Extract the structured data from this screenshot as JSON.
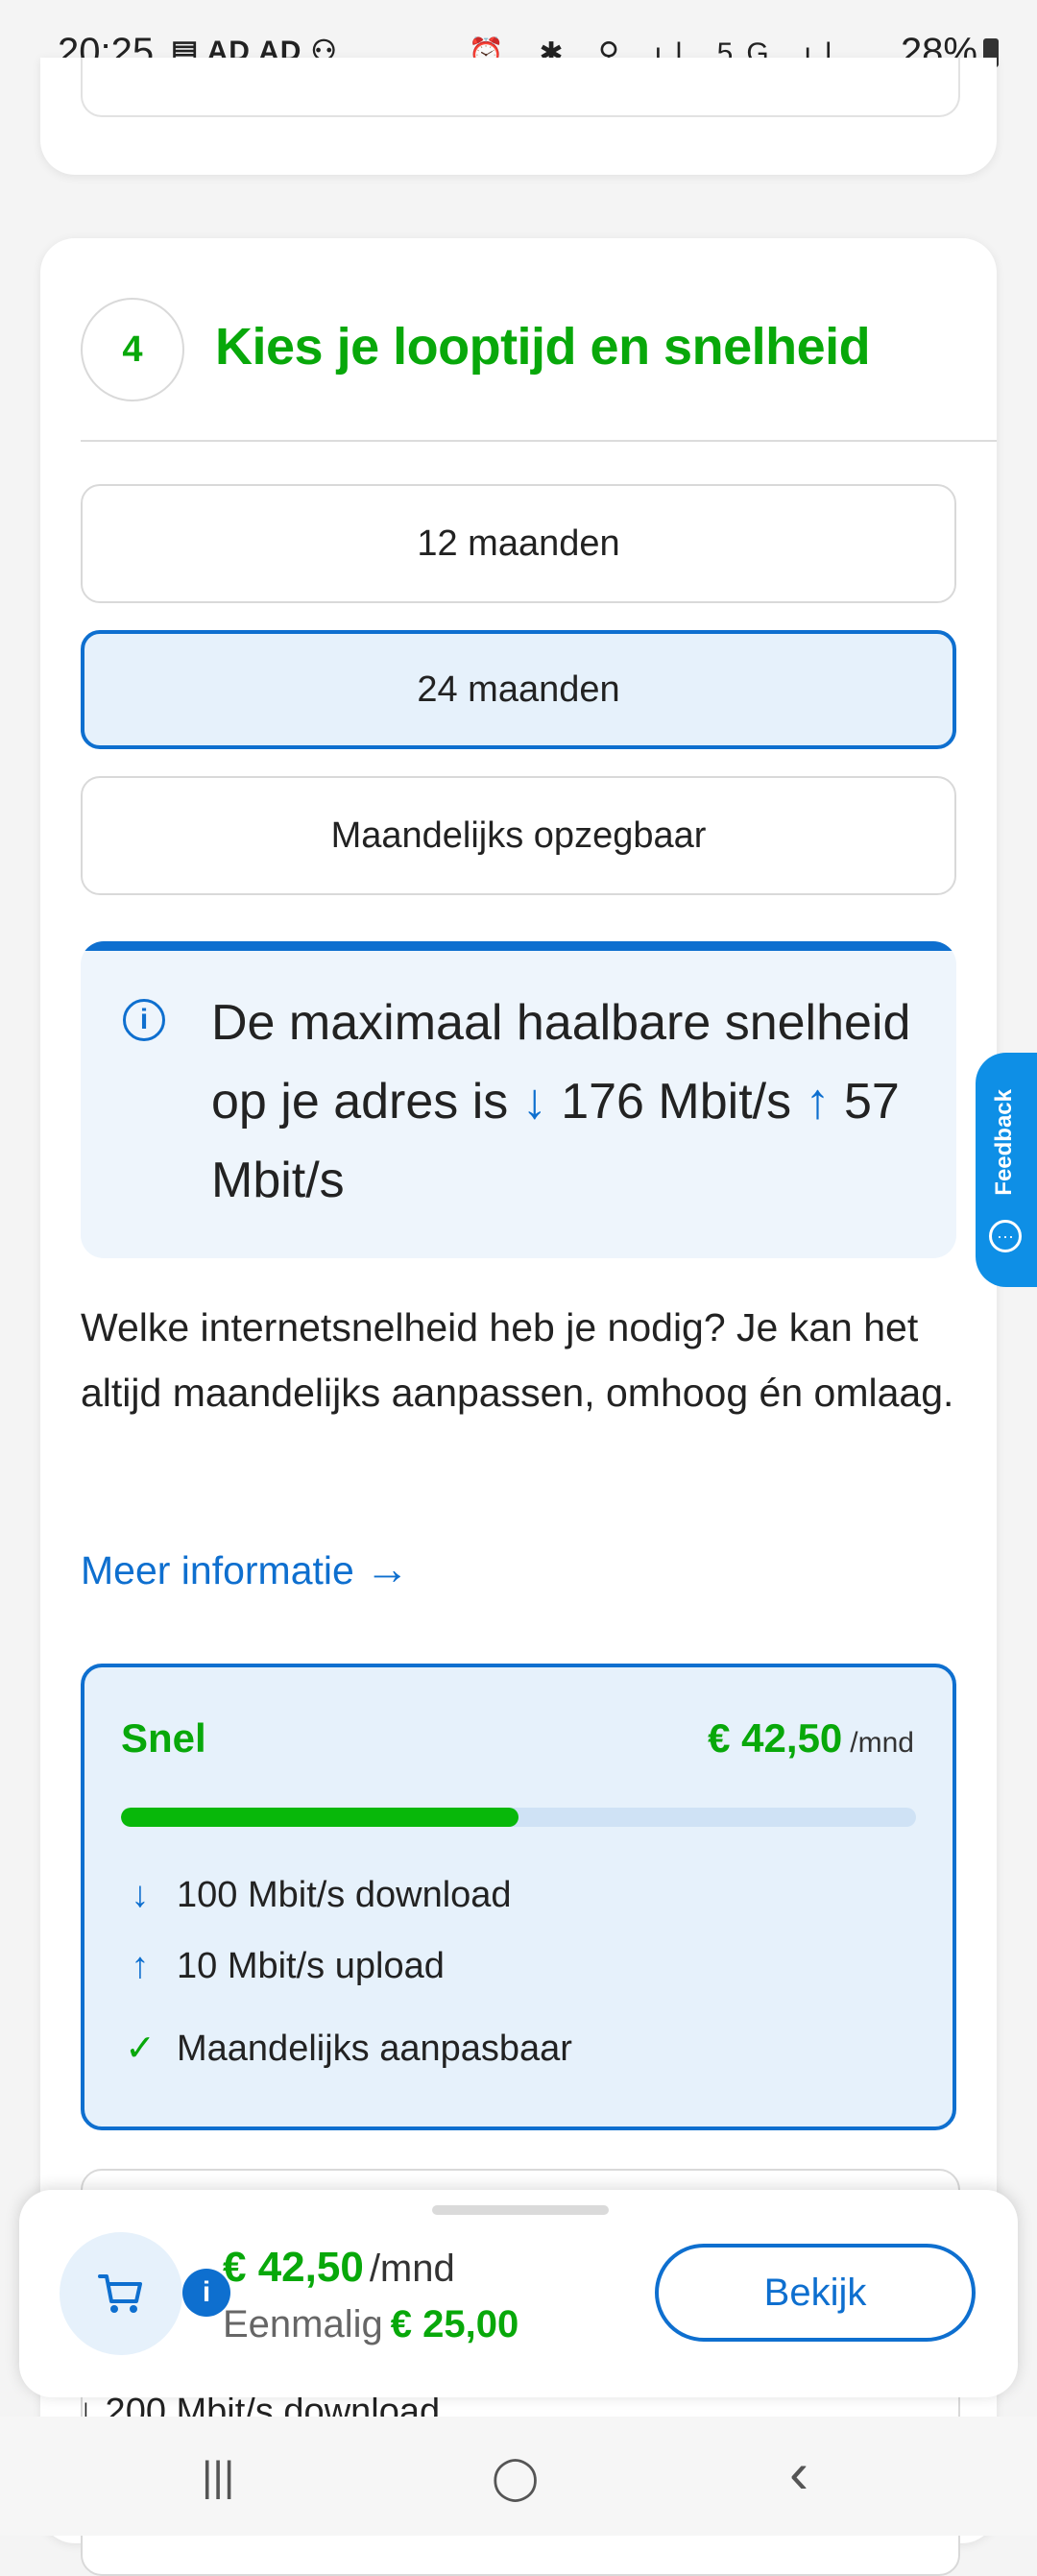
{
  "status_bar": {
    "time": "20:25",
    "left_icons": "▤ AD AD ⚇",
    "right_icons": "⏰ ✱ ⚲ ıl 5G ıl",
    "battery": "28%"
  },
  "step": {
    "number": "4",
    "title": "Kies je looptijd en snelheid"
  },
  "terms": [
    {
      "label": "12 maanden",
      "selected": false
    },
    {
      "label": "24 maanden",
      "selected": true
    },
    {
      "label": "Maandelijks opzegbaar",
      "selected": false
    }
  ],
  "info": {
    "icon": "info-icon",
    "text_before": "De maximaal haalbare snelheid op je adres is",
    "down_arrow": "↓",
    "down_value": "176 Mbit/s",
    "up_arrow": "↑",
    "up_value": "57 Mbit/s"
  },
  "question": "Welke internetsnelheid heb je nodig? Je kan het altijd maandelijks aanpassen, omhoog én omlaag.",
  "more_info": {
    "label": "Meer informatie",
    "arrow": "→"
  },
  "speed_option": {
    "name": "Snel",
    "price": "€ 42,50",
    "unit": "/mnd",
    "level_fraction": 0.5,
    "features": [
      {
        "icon": "↓",
        "text": "100 Mbit/s download"
      },
      {
        "icon": "↑",
        "text": "10 Mbit/s upload"
      },
      {
        "icon": "✓",
        "text": "Maandelijks aanpasbaar"
      }
    ]
  },
  "next_option_feature": "↓ 200 Mbit/s download",
  "feedback": {
    "label": "Feedback"
  },
  "summary": {
    "badge": "i",
    "price": "€ 42,50",
    "per": "/mnd",
    "once_label": "Eenmalig",
    "once_value": "€ 25,00",
    "button": "Bekijk"
  },
  "navbar": {
    "recent": "|||",
    "home": "◯",
    "back": "‹"
  },
  "colors": {
    "green": "#08a80a",
    "blue": "#0e6fcf"
  }
}
